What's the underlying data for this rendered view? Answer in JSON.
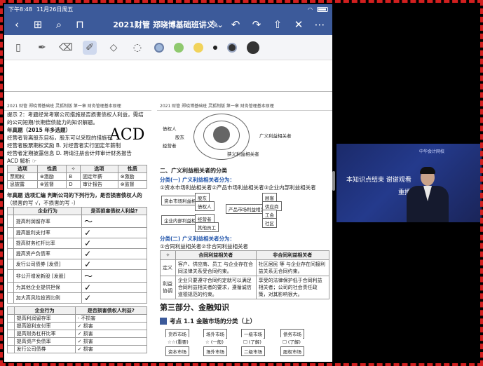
{
  "status": {
    "time": "下午8:48",
    "date": "11月26日周五",
    "battery": ""
  },
  "nav": {
    "title": "2021财管 郑晓博基础班讲义 ⌄",
    "back_icon": "chevron-left-icon",
    "grid_icon": "grid-icon",
    "search_icon": "search-icon",
    "bookmark_icon": "bookmark-icon",
    "share_icon": "share-icon"
  },
  "toolbar": {
    "colors": [
      "#9fb7d9",
      "#8fc96f",
      "#f1d35b"
    ]
  },
  "doc": {
    "left_header": "2021 财管  郑晓博基础班  灵狐制版  第一章  财务管理基本原理",
    "right_header": "2021 财管  郑晓博基础班  灵狐制版  第一章  财务管理基本原理",
    "left": {
      "hint": "提示 2：考题经常考察公司措施是否损害债权人利益，需结",
      "hint2": "的公司短期/长期偿债能力的知识解题。",
      "real_title": "年真题（2015 年多选题）",
      "q_line1": "经营者背离股东目标，股东可以采取的措施有",
      "q_line2": "经营者股票期权奖励    B. 对经营者实行固定年薪制",
      "q_line3": "经营者定期披露信息    D. 聘请注册会计师审计财务报告",
      "answer": "ACD   解析 ☞",
      "handwriting": "ACD",
      "opt_table": {
        "headers": [
          "选项",
          "性质",
          "✧",
          "选项",
          "性质"
        ],
        "rows": [
          [
            "票期权",
            "⊗激励",
            "B",
            "固定年薪",
            "⊗激励"
          ],
          [
            "息披露",
            "⊗监督",
            "D",
            "审计报告",
            "⊗监督"
          ]
        ]
      },
      "real2_title": "年真题  选项汇编  判断公司的下列行为，是否损害债权人的",
      "real2_sub": "（损害的写 √，不损害的写 -）",
      "act_table": {
        "headers": [
          "",
          "企业行为",
          "是否损害债权人利益?"
        ],
        "rows": [
          [
            "",
            "提高利润留存率",
            "〜"
          ],
          [
            "",
            "提高股利支付率",
            "✓"
          ],
          [
            "",
            "提高财务杠杆比率",
            "✓"
          ],
          [
            "",
            "提高资产负债率",
            "✓"
          ],
          [
            "",
            "发行公司债券 [发债]",
            "✓"
          ],
          [
            "",
            "非公开增发新股 [发股]",
            "〜"
          ],
          [
            "",
            "为其他企业提供担保",
            "✓"
          ],
          [
            "",
            "加大高风险投资比例",
            "✓"
          ]
        ]
      },
      "act_table2": {
        "headers": [
          "",
          "企业行为",
          "是否损害债权人利益?"
        ],
        "rows": [
          [
            "",
            "提高利润留存率",
            "- 不损害"
          ],
          [
            "",
            "提高股利支付率",
            "✓ 损害"
          ],
          [
            "",
            "提高财务杠杆比率",
            "✓ 损害"
          ],
          [
            "",
            "提高资产负债率",
            "✓ 损害"
          ],
          [
            "",
            "发行公司债券",
            "✓ 损害"
          ]
        ]
      }
    },
    "right": {
      "orbit_labels": [
        "债权人",
        "股东",
        "经营者",
        "狭义利益相关者",
        "广义利益相关者"
      ],
      "section2": "二、广义利益相关者的分类",
      "cat1_title": "分类(一) 广义利益相关者分为：",
      "cat1_desc": "①资本市场利益相关者②产品市场利益相关者③企业内部利益相关者",
      "boxes": {
        "capital": "资本市场利益相关者",
        "shareholder": "股东",
        "creditor": "债权人",
        "product": "产品市场利益相关者",
        "customer": "顾客",
        "supplier": "供应商",
        "union": "工会",
        "community": "社区",
        "internal": "企业内部利益相关者",
        "manager": "经营者",
        "staff": "其他员工"
      },
      "cat2_title": "分类(二) 广义利益相关者分为：",
      "cat2_desc": "①合同利益相关者②非合同利益相关者",
      "rt_headers": [
        "✧",
        "合同利益相关者",
        "非合同利益相关者"
      ],
      "rt_rows": [
        [
          "定义",
          "客户、供应商、员工 与企业存在合同法律关系受合同约束。",
          "社区居民 等 与企业存在间接利益关系无合同约束。"
        ],
        [
          "利益协调",
          "企业只要遵守合同约定就可以满足合同利益相关者的要求，遵循诚信道德规范的约束。",
          "享受的法律保护低于合同利益相关者；公司的社会责任政策，对其影响很大。"
        ]
      ],
      "part3": "第三部分、金融知识",
      "topic": "考点 1.1  金融市场的分类（上）",
      "market_boxes": [
        "货币市场",
        "场外市场",
        "一级市场",
        "债务市场",
        "☆☆(重要)",
        "☆ (一般)",
        "☐ (了解)",
        "☐ (了解)",
        "资本市场",
        "场外市场",
        "二级市场",
        "股权市场"
      ]
    }
  },
  "video": {
    "brand": "中华会计网校",
    "caption": "本知识点结束 谢谢观看",
    "caption2": "重播"
  }
}
